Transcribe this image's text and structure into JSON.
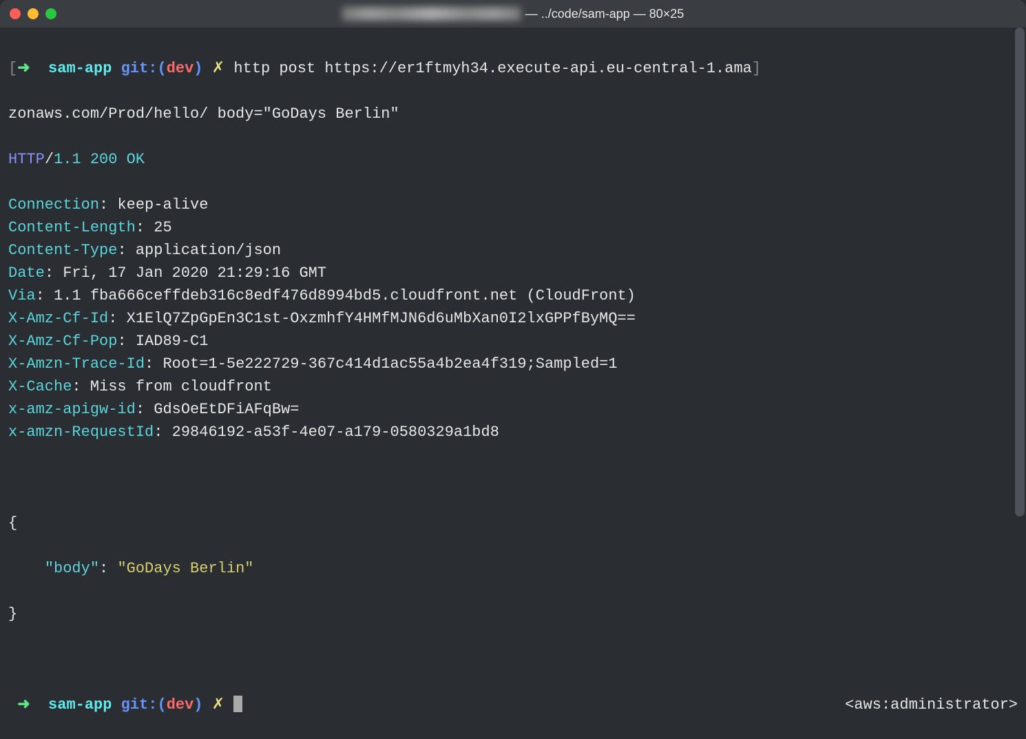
{
  "title": {
    "path": "— ../code/sam-app — 80×25"
  },
  "prompt": {
    "bracket_open": "[",
    "arrow": "➜",
    "dir": "sam-app",
    "git_label": "git:(",
    "branch": "dev",
    "git_close": ")",
    "dirty": "✗",
    "bracket_close": "]"
  },
  "command": {
    "full": "http post https://er1ftmyh34.execute-api.eu-central-1.amazonaws.com/Prod/hello/ body=\"GoDays Berlin\"",
    "part1": "http post https://er1ftmyh34.execute-api.eu-central-1.ama",
    "part2": "zonaws.com/Prod/hello/ body=\"GoDays Berlin\""
  },
  "response": {
    "protocol": "HTTP",
    "slash": "/",
    "version": "1.1",
    "status_code": "200",
    "status_text": "OK",
    "headers": [
      {
        "name": "Connection",
        "value": "keep-alive"
      },
      {
        "name": "Content-Length",
        "value": "25"
      },
      {
        "name": "Content-Type",
        "value": "application/json"
      },
      {
        "name": "Date",
        "value": "Fri, 17 Jan 2020 21:29:16 GMT"
      },
      {
        "name": "Via",
        "value": "1.1 fba666ceffdeb316c8edf476d8994bd5.cloudfront.net (CloudFront)"
      },
      {
        "name": "X-Amz-Cf-Id",
        "value": "X1ElQ7ZpGpEn3C1st-OxzmhfY4HMfMJN6d6uMbXan0I2lxGPPfByMQ=="
      },
      {
        "name": "X-Amz-Cf-Pop",
        "value": "IAD89-C1"
      },
      {
        "name": "X-Amzn-Trace-Id",
        "value": "Root=1-5e222729-367c414d1ac55a4b2ea4f319;Sampled=1"
      },
      {
        "name": "X-Cache",
        "value": "Miss from cloudfront"
      },
      {
        "name": "x-amz-apigw-id",
        "value": "GdsOeEtDFiAFqBw="
      },
      {
        "name": "x-amzn-RequestId",
        "value": "29846192-a53f-4e07-a179-0580329a1bd8"
      }
    ]
  },
  "body": {
    "open": "{",
    "key": "\"body\"",
    "colon": ":",
    "value": "\"GoDays Berlin\"",
    "close": "}"
  },
  "status_right": "<aws:administrator>"
}
